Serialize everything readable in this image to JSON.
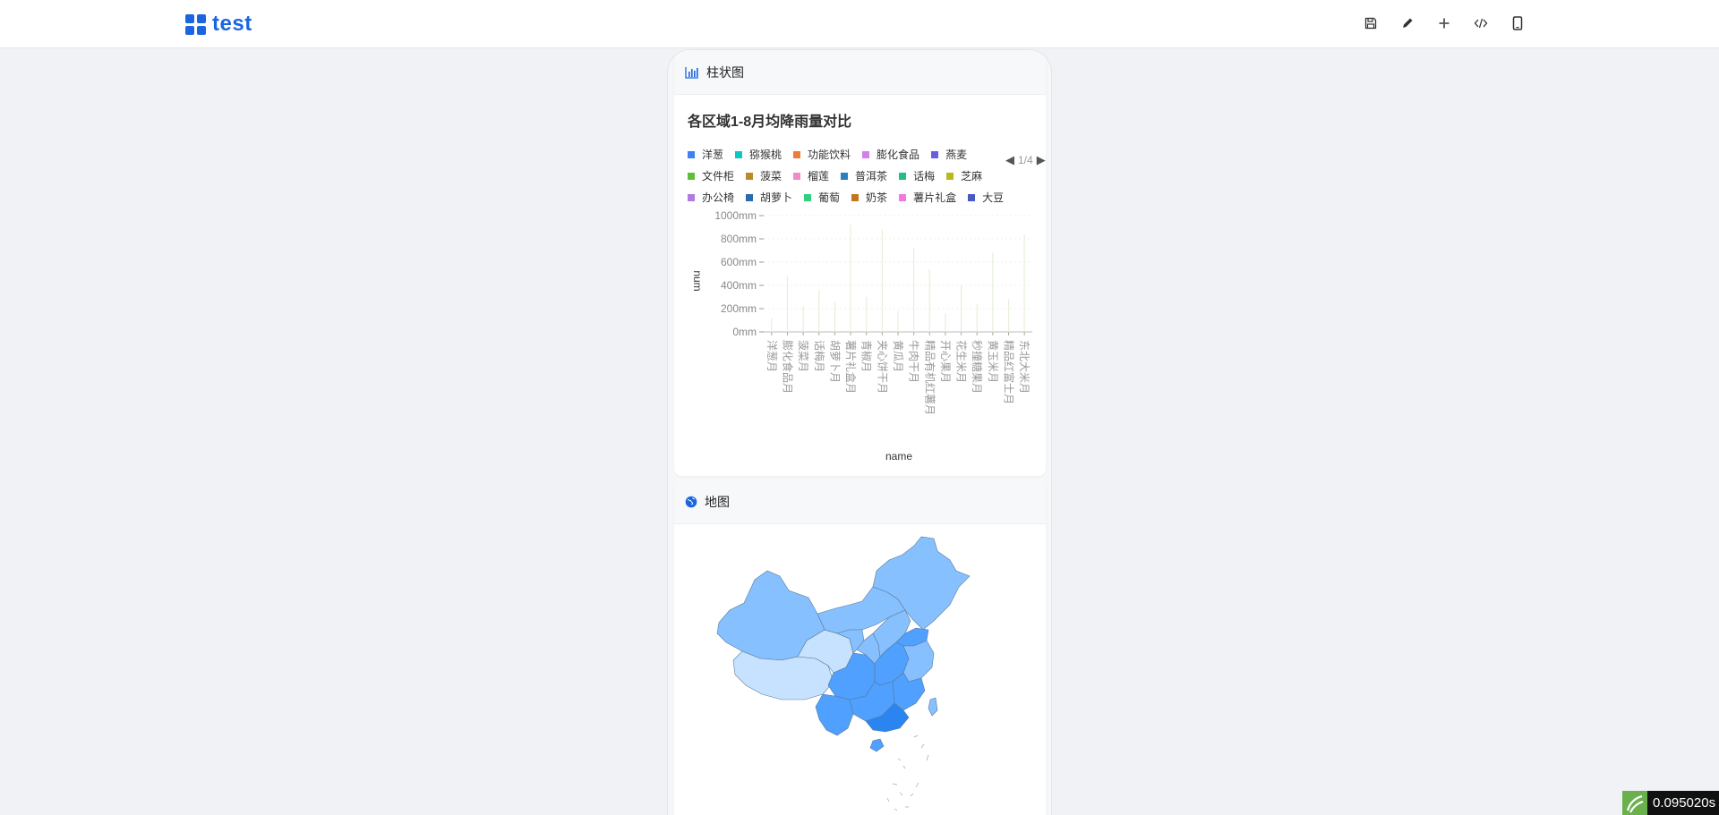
{
  "app": {
    "title": "test"
  },
  "toolbar": [
    "save-icon",
    "edit-icon",
    "plus-icon",
    "code-icon",
    "mobile-icon"
  ],
  "bar_card": {
    "header": "柱状图",
    "legend": [
      [
        "洋葱",
        "猕猴桃",
        "功能饮料",
        "膨化食品",
        "燕麦"
      ],
      [
        "文件柜",
        "菠菜",
        "榴莲",
        "普洱茶",
        "话梅",
        "芝麻"
      ],
      [
        "办公椅",
        "胡萝卜",
        "葡萄",
        "奶茶",
        "薯片礼盒",
        "大豆"
      ]
    ],
    "legend_colors": [
      [
        "#3b82f6",
        "#14c4c4",
        "#f07a3a",
        "#d67df0",
        "#6a5fe0"
      ],
      [
        "#5fbf3a",
        "#b88a2a",
        "#f08ac8",
        "#2a80c0",
        "#20c080",
        "#b8b820"
      ],
      [
        "#b07ae0",
        "#2a6ab0",
        "#30d080",
        "#c07820",
        "#f07ae0",
        "#4a5ac0"
      ]
    ],
    "legend_page": "1/4"
  },
  "chart_data": {
    "type": "bar",
    "title": "各区域1-8月均降雨量对比",
    "xlabel": "name",
    "ylabel": "num",
    "y_ticks": [
      "1000mm",
      "800mm",
      "600mm",
      "400mm",
      "200mm",
      "0mm"
    ],
    "ylim": [
      0,
      1000
    ],
    "grid": true,
    "legend_position": "top",
    "categories": [
      "洋葱月",
      "膨化食品月",
      "菠菜月",
      "话梅月",
      "胡萝卜月",
      "薯片礼盒月",
      "青椒月",
      "夹心饼干月",
      "黄瓜月",
      "牛肉干月",
      "精品有机红薯月",
      "开心果月",
      "花生米月",
      "秒撞糖果月",
      "黄玉米月",
      "精品红富士月",
      "东北大米月"
    ],
    "values": [
      120,
      480,
      220,
      360,
      260,
      920,
      300,
      880,
      180,
      720,
      540,
      160,
      400,
      240,
      680,
      280,
      840
    ]
  },
  "map_card": {
    "header": "地图"
  },
  "timer": "0.095020s",
  "colors": {
    "accent": "#1a66e0",
    "map_light": "#c6e2ff",
    "map_mid": "#87c0ff",
    "map_dark": "#4fa0ff",
    "map_darkest": "#2b85f0"
  }
}
